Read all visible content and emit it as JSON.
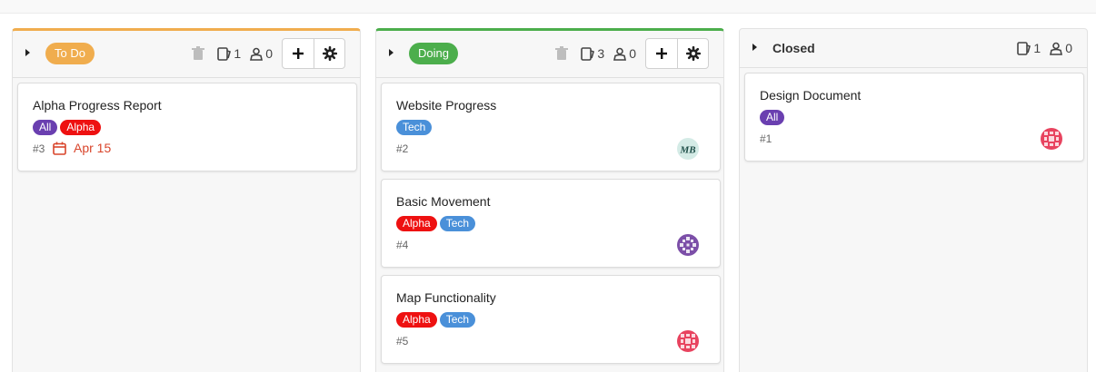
{
  "columns": [
    {
      "status": "To Do",
      "status_color": "#f0ad4e",
      "card_count": "1",
      "user_count": "0",
      "cards": [
        {
          "title": "Alpha Progress Report",
          "tags": [
            {
              "label": "All",
              "color": "#6a3fb0"
            },
            {
              "label": "Alpha",
              "color": "#ee1111"
            }
          ],
          "number": "#3",
          "due": "Apr 15"
        }
      ]
    },
    {
      "status": "Doing",
      "status_color": "#4cae4c",
      "card_count": "3",
      "user_count": "0",
      "cards": [
        {
          "title": "Website Progress",
          "tags": [
            {
              "label": "Tech",
              "color": "#4a90d9"
            }
          ],
          "number": "#2",
          "avatar": "MB"
        },
        {
          "title": "Basic Movement",
          "tags": [
            {
              "label": "Alpha",
              "color": "#ee1111"
            },
            {
              "label": "Tech",
              "color": "#4a90d9"
            }
          ],
          "number": "#4"
        },
        {
          "title": "Map Functionality",
          "tags": [
            {
              "label": "Alpha",
              "color": "#ee1111"
            },
            {
              "label": "Tech",
              "color": "#4a90d9"
            }
          ],
          "number": "#5"
        }
      ]
    },
    {
      "status": "Closed",
      "card_count": "1",
      "user_count": "0",
      "cards": [
        {
          "title": "Design Document",
          "tags": [
            {
              "label": "All",
              "color": "#6a3fb0"
            }
          ],
          "number": "#1"
        }
      ]
    }
  ]
}
